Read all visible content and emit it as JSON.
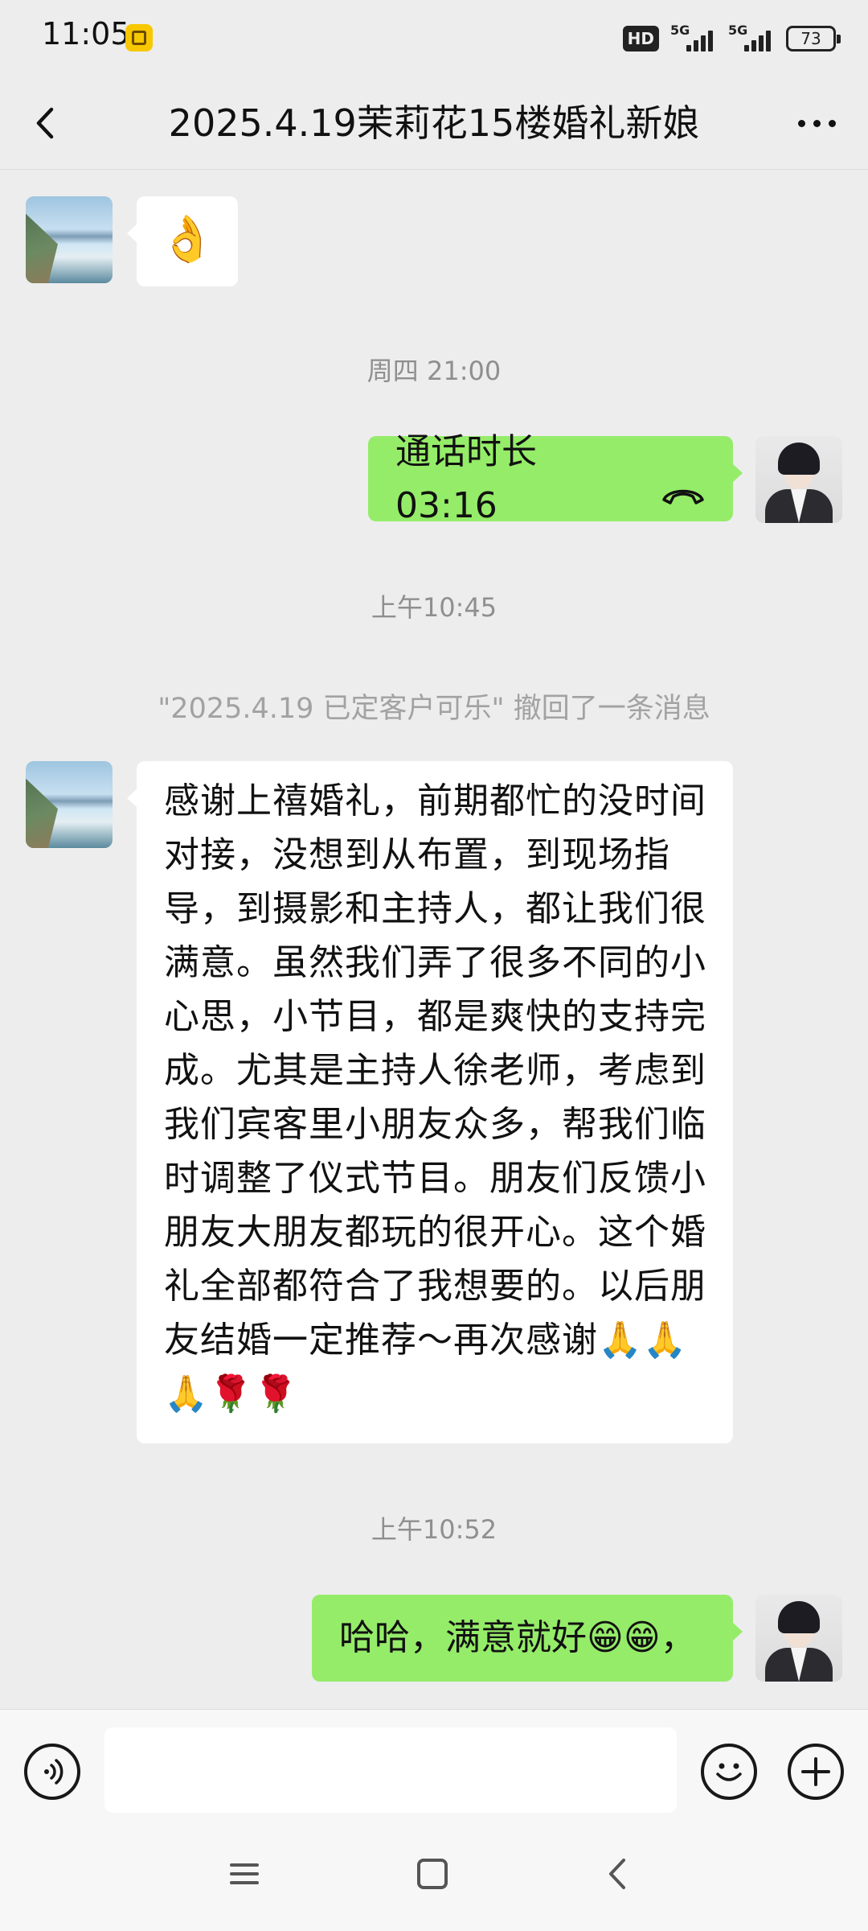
{
  "status_bar": {
    "time": "11:05",
    "hd_label": "HD",
    "network_1": "5G",
    "network_2": "5G",
    "battery": "73"
  },
  "header": {
    "title": "2025.4.19茉莉花15楼婚礼新娘",
    "back_icon": "chevron-left-icon",
    "more_icon": "more-dots-icon"
  },
  "messages": [
    {
      "side": "left",
      "type": "emoji",
      "content": "👌"
    },
    {
      "type": "time",
      "content": "周四 21:00"
    },
    {
      "side": "right",
      "type": "call",
      "content": "通话时长 03:16",
      "icon": "phone-hangup-icon"
    },
    {
      "type": "time",
      "content": "上午10:45"
    },
    {
      "type": "system",
      "content": "\"2025.4.19 已定客户可乐\" 撤回了一条消息"
    },
    {
      "side": "left",
      "type": "text",
      "content": "感谢上禧婚礼，前期都忙的没时间对接，没想到从布置，到现场指导，到摄影和主持人，都让我们很满意。虽然我们弄了很多不同的小心思，小节目，都是爽快的支持完成。尤其是主持人徐老师，考虑到我们宾客里小朋友众多，帮我们临时调整了仪式节目。朋友们反馈小朋友大朋友都玩的很开心。这个婚礼全部都符合了我想要的。以后朋友结婚一定推荐～再次感谢🙏🙏🙏🌹🌹"
    },
    {
      "type": "time",
      "content": "上午10:52"
    },
    {
      "side": "right",
      "type": "text",
      "content": "哈哈，满意就好😁😁，"
    }
  ],
  "input_bar": {
    "voice_icon": "voice-icon",
    "input_value": "",
    "emoji_icon": "smiley-icon",
    "plus_icon": "plus-icon"
  },
  "nav_bar": {
    "menu_icon": "menu-icon",
    "home_icon": "home-square-icon",
    "back_icon": "back-arrow-icon"
  }
}
